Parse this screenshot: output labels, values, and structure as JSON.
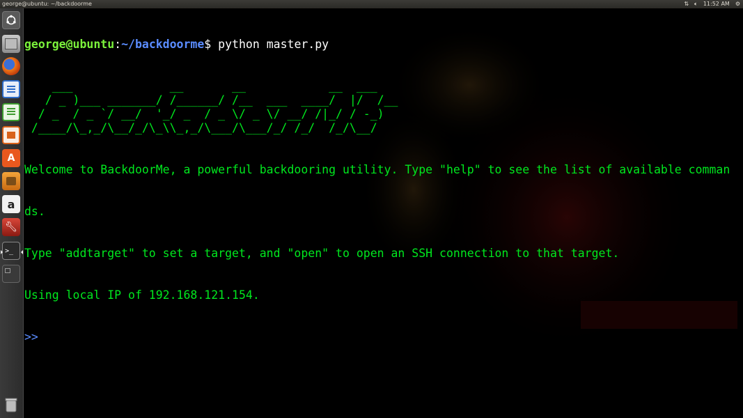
{
  "top_panel": {
    "window_title": "george@ubuntu: ~/backdoorme",
    "clock": "11:52 AM",
    "network_icon": "network-arrows-icon",
    "volume_icon": "volume-icon",
    "settings_icon": "gear-icon"
  },
  "launcher": {
    "items": [
      {
        "name": "dash-home",
        "icon": "ubuntu-logo-icon"
      },
      {
        "name": "files",
        "icon": "file-cabinet-icon"
      },
      {
        "name": "firefox",
        "icon": "firefox-icon"
      },
      {
        "name": "libreoffice-writer",
        "icon": "writer-icon"
      },
      {
        "name": "libreoffice-calc",
        "icon": "calc-icon"
      },
      {
        "name": "libreoffice-impress",
        "icon": "impress-icon"
      },
      {
        "name": "ubuntu-software-center",
        "icon": "software-center-icon"
      },
      {
        "name": "update-manager",
        "icon": "updates-icon"
      },
      {
        "name": "amazon",
        "icon": "amazon-icon"
      },
      {
        "name": "system-settings",
        "icon": "tools-icon"
      },
      {
        "name": "terminal",
        "icon": "terminal-icon"
      },
      {
        "name": "workspace-switcher",
        "icon": "workspaces-icon"
      },
      {
        "name": "trash",
        "icon": "trash-icon"
      }
    ]
  },
  "terminal": {
    "prompt_user": "george@ubuntu",
    "prompt_sep": ":",
    "prompt_path": "~/backdoorme",
    "prompt_dollar": "$",
    "command": " python master.py",
    "ascii_art": "    ___              __       __            __  ___\n   / _ )___ _______/ /______/ /__  ___  ____/  |/  /__\n  / _  / _ `/ __/  '_/ _  / _ \\/ _ \\/ __/ /|_/ / -_)\n /____/\\_,_/\\__/_/\\_\\\\_,_/\\___/\\___/_/ /_/  /_/\\__/",
    "output_lines": [
      "Welcome to BackdoorMe, a powerful backdooring utility. Type \"help\" to see the list of available comman",
      "ds.",
      "Type \"addtarget\" to set a target, and \"open\" to open an SSH connection to that target.",
      "Using local IP of 192.168.121.154."
    ],
    "next_prompt": ">>"
  },
  "colors": {
    "terminal_text": "#00e81e",
    "prompt_user": "#7bf23b",
    "prompt_path": "#5a8cff",
    "background": "#000000"
  }
}
